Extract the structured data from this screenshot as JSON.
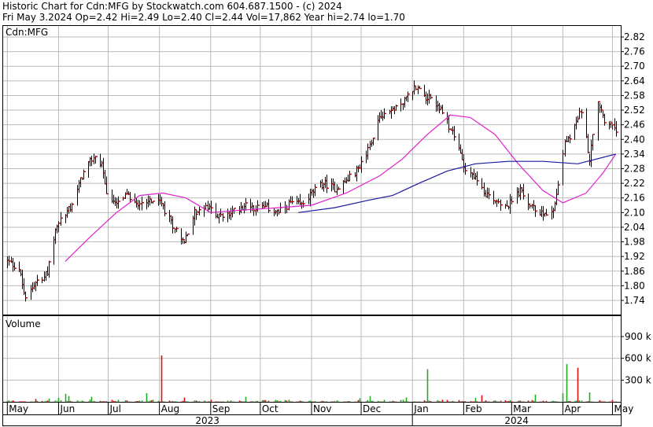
{
  "header": {
    "line1": "Historic Chart for Cdn:MFG by Stockwatch.com 604.687.1500 - (c) 2024",
    "line2": "Fri May  3.2024   Op=2.42   Hi=2.49   Lo=2.40   Cl=2.44   Vol=17,862   Year hi=2.74   lo=1.70"
  },
  "price_panel": {
    "label": "Cdn:MFG"
  },
  "volume_panel": {
    "label": "Volume"
  },
  "colors": {
    "price_bars": "#000000",
    "close_tick": "#cc0000",
    "ma_short": "#dd22cc",
    "ma_long": "#1a1aa0",
    "vol_up": "#22aa22",
    "vol_down": "#dd1111",
    "grid": "#bbbbbb"
  },
  "chart_data": [
    {
      "type": "ohlc",
      "title": "",
      "ylim": [
        1.7,
        2.85
      ],
      "y_ticks": [
        "2.82",
        "2.76",
        "2.70",
        "2.64",
        "2.58",
        "2.52",
        "2.46",
        "2.40",
        "2.34",
        "2.28",
        "2.22",
        "2.16",
        "2.10",
        "2.04",
        "1.98",
        "1.92",
        "1.86",
        "1.80",
        "1.74"
      ],
      "x_months": [
        "May",
        "Jun",
        "Jul",
        "Aug",
        "Sep",
        "Oct",
        "Nov",
        "Dec",
        "Jan",
        "Feb",
        "Mar",
        "Apr",
        "May"
      ],
      "x_years": [
        "2023",
        "2024"
      ],
      "grid": true,
      "price_anchors": [
        [
          "2023-05-01",
          1.9
        ],
        [
          "2023-05-08",
          1.87
        ],
        [
          "2023-05-12",
          1.74
        ],
        [
          "2023-05-18",
          1.82
        ],
        [
          "2023-05-25",
          1.85
        ],
        [
          "2023-05-31",
          2.05
        ],
        [
          "2023-06-08",
          2.12
        ],
        [
          "2023-06-15",
          2.25
        ],
        [
          "2023-06-22",
          2.33
        ],
        [
          "2023-06-27",
          2.3
        ],
        [
          "2023-06-30",
          2.18
        ],
        [
          "2023-07-05",
          2.13
        ],
        [
          "2023-07-12",
          2.17
        ],
        [
          "2023-07-19",
          2.14
        ],
        [
          "2023-07-26",
          2.15
        ],
        [
          "2023-08-01",
          2.14
        ],
        [
          "2023-08-09",
          2.05
        ],
        [
          "2023-08-16",
          1.98
        ],
        [
          "2023-08-22",
          2.1
        ],
        [
          "2023-08-30",
          2.12
        ],
        [
          "2023-09-07",
          2.08
        ],
        [
          "2023-09-14",
          2.1
        ],
        [
          "2023-09-21",
          2.13
        ],
        [
          "2023-09-28",
          2.12
        ],
        [
          "2023-10-05",
          2.12
        ],
        [
          "2023-10-12",
          2.1
        ],
        [
          "2023-10-19",
          2.14
        ],
        [
          "2023-10-26",
          2.13
        ],
        [
          "2023-11-01",
          2.18
        ],
        [
          "2023-11-08",
          2.22
        ],
        [
          "2023-11-15",
          2.2
        ],
        [
          "2023-11-22",
          2.23
        ],
        [
          "2023-11-29",
          2.28
        ],
        [
          "2023-12-05",
          2.36
        ],
        [
          "2023-12-12",
          2.5
        ],
        [
          "2023-12-19",
          2.52
        ],
        [
          "2023-12-26",
          2.55
        ],
        [
          "2024-01-03",
          2.62
        ],
        [
          "2024-01-08",
          2.58
        ],
        [
          "2024-01-15",
          2.55
        ],
        [
          "2024-01-22",
          2.47
        ],
        [
          "2024-01-29",
          2.36
        ],
        [
          "2024-02-02",
          2.28
        ],
        [
          "2024-02-07",
          2.25
        ],
        [
          "2024-02-14",
          2.18
        ],
        [
          "2024-02-21",
          2.15
        ],
        [
          "2024-02-28",
          2.13
        ],
        [
          "2024-03-06",
          2.19
        ],
        [
          "2024-03-13",
          2.12
        ],
        [
          "2024-03-20",
          2.09
        ],
        [
          "2024-03-27",
          2.13
        ],
        [
          "2024-04-02",
          2.38
        ],
        [
          "2024-04-08",
          2.45
        ],
        [
          "2024-04-12",
          2.52
        ],
        [
          "2024-04-17",
          2.32
        ],
        [
          "2024-04-22",
          2.55
        ],
        [
          "2024-04-26",
          2.48
        ],
        [
          "2024-05-03",
          2.44
        ]
      ],
      "ma_short_anchors": [
        [
          "2023-06-05",
          1.9
        ],
        [
          "2023-06-20",
          2.0
        ],
        [
          "2023-07-06",
          2.1
        ],
        [
          "2023-07-20",
          2.17
        ],
        [
          "2023-08-03",
          2.18
        ],
        [
          "2023-08-17",
          2.16
        ],
        [
          "2023-09-01",
          2.1
        ],
        [
          "2023-09-20",
          2.11
        ],
        [
          "2023-10-12",
          2.12
        ],
        [
          "2023-11-01",
          2.13
        ],
        [
          "2023-11-22",
          2.18
        ],
        [
          "2023-12-12",
          2.25
        ],
        [
          "2023-12-26",
          2.32
        ],
        [
          "2024-01-10",
          2.42
        ],
        [
          "2024-01-24",
          2.5
        ],
        [
          "2024-02-05",
          2.49
        ],
        [
          "2024-02-20",
          2.42
        ],
        [
          "2024-03-05",
          2.3
        ],
        [
          "2024-03-20",
          2.19
        ],
        [
          "2024-04-01",
          2.14
        ],
        [
          "2024-04-15",
          2.18
        ],
        [
          "2024-04-25",
          2.26
        ],
        [
          "2024-05-03",
          2.34
        ]
      ],
      "ma_long_anchors": [
        [
          "2023-10-24",
          2.1
        ],
        [
          "2023-11-15",
          2.12
        ],
        [
          "2023-12-05",
          2.15
        ],
        [
          "2023-12-20",
          2.17
        ],
        [
          "2024-01-05",
          2.22
        ],
        [
          "2024-01-22",
          2.27
        ],
        [
          "2024-02-08",
          2.3
        ],
        [
          "2024-02-28",
          2.31
        ],
        [
          "2024-03-20",
          2.31
        ],
        [
          "2024-04-10",
          2.3
        ],
        [
          "2024-05-03",
          2.34
        ]
      ]
    },
    {
      "type": "bar",
      "title": "Volume",
      "ylim": [
        0,
        1100
      ],
      "y_ticks": [
        "900 k",
        "600 k",
        "300 k"
      ],
      "spikes": [
        [
          "2023-05-18",
          40,
          "down"
        ],
        [
          "2023-05-26",
          45,
          "up"
        ],
        [
          "2023-06-01",
          55,
          "up"
        ],
        [
          "2023-06-05",
          110,
          "up"
        ],
        [
          "2023-06-07",
          80,
          "up"
        ],
        [
          "2023-06-21",
          70,
          "up"
        ],
        [
          "2023-07-24",
          120,
          "up"
        ],
        [
          "2023-08-02",
          640,
          "down"
        ],
        [
          "2023-08-13",
          1050,
          "down"
        ],
        [
          "2023-08-16",
          60,
          "down"
        ],
        [
          "2023-09-22",
          70,
          "up"
        ],
        [
          "2023-11-30",
          50,
          "up"
        ],
        [
          "2023-12-06",
          80,
          "up"
        ],
        [
          "2023-12-28",
          60,
          "up"
        ],
        [
          "2024-01-10",
          450,
          "up"
        ],
        [
          "2024-02-08",
          55,
          "up"
        ],
        [
          "2024-02-12",
          90,
          "down"
        ],
        [
          "2024-03-15",
          100,
          "up"
        ],
        [
          "2024-04-01",
          120,
          "up"
        ],
        [
          "2024-04-03",
          520,
          "up"
        ],
        [
          "2024-04-10",
          470,
          "down"
        ],
        [
          "2024-04-17",
          130,
          "up"
        ]
      ]
    }
  ]
}
